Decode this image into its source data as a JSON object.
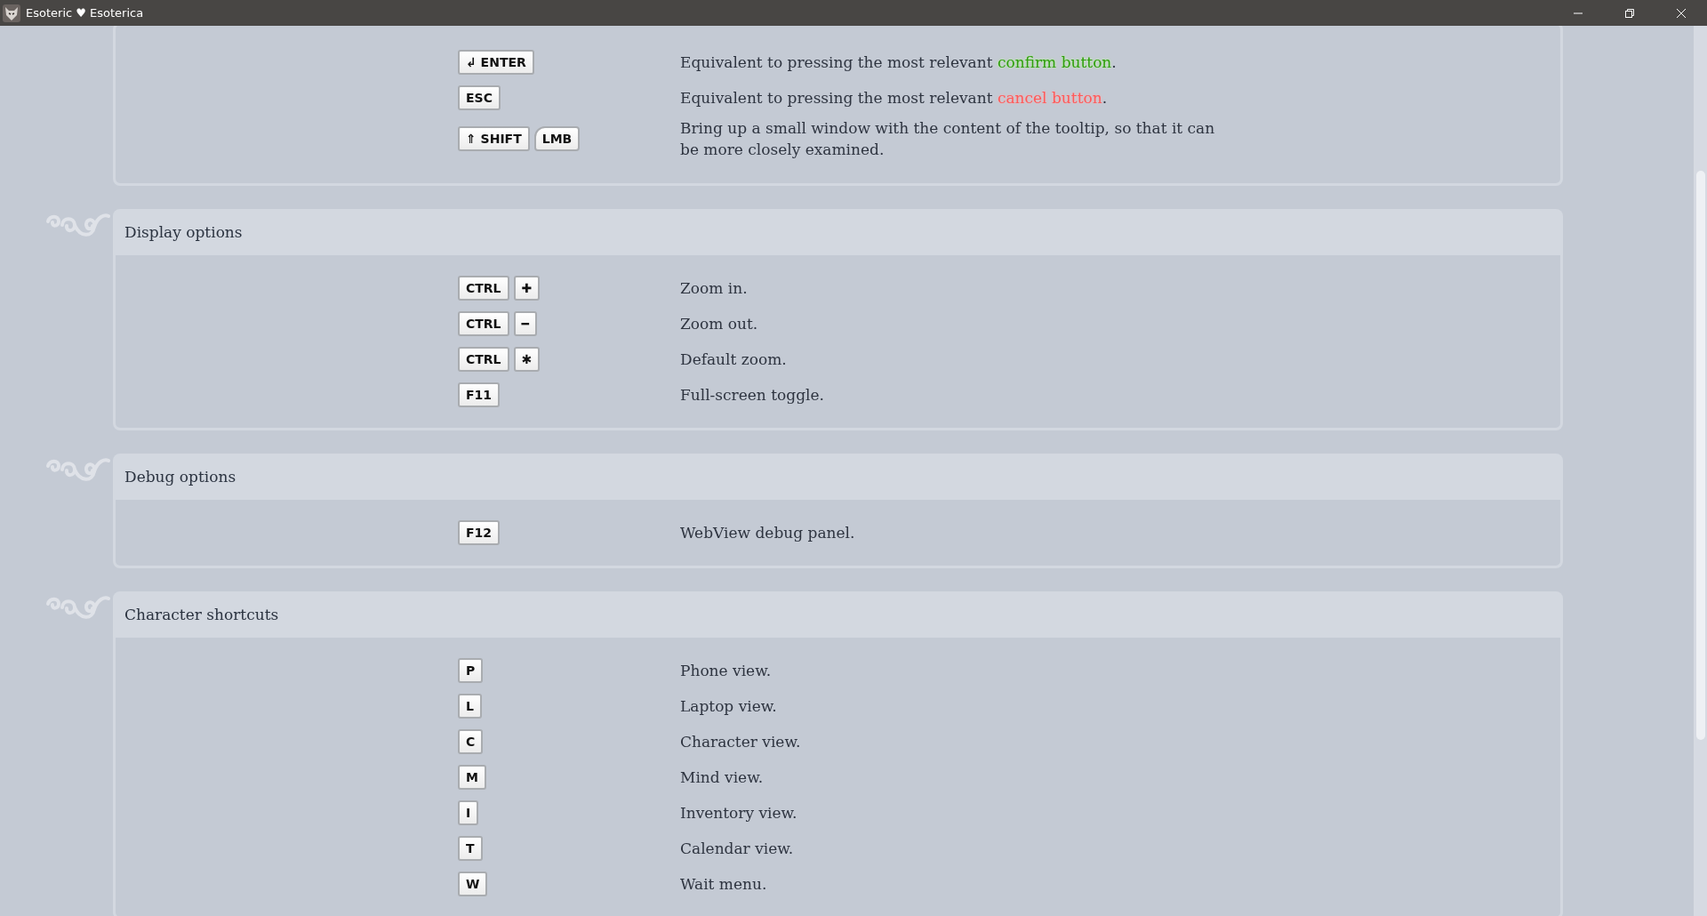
{
  "window": {
    "title": "Esoteric ♥ Esoterica"
  },
  "sections": [
    {
      "rows": [
        {
          "keys": [
            {
              "label": "↲ ENTER",
              "kind": "key"
            }
          ],
          "description": [
            {
              "text": "Equivalent to pressing the most relevant ",
              "kind": "plain"
            },
            {
              "text": "confirm button",
              "kind": "confirm"
            },
            {
              "text": ".",
              "kind": "plain"
            }
          ]
        },
        {
          "keys": [
            {
              "label": "ESC",
              "kind": "key"
            }
          ],
          "description": [
            {
              "text": "Equivalent to pressing the most relevant ",
              "kind": "plain"
            },
            {
              "text": "cancel button",
              "kind": "cancel"
            },
            {
              "text": ".",
              "kind": "plain"
            }
          ]
        },
        {
          "keys": [
            {
              "label": "⇑ SHIFT",
              "kind": "key"
            },
            {
              "label": "LMB",
              "kind": "mouse"
            }
          ],
          "description": [
            {
              "text": "Bring up a small window with the content of the tooltip, so that it can be more closely examined.",
              "kind": "plain"
            }
          ]
        }
      ]
    },
    {
      "title": "Display options",
      "rows": [
        {
          "keys": [
            {
              "label": "CTRL",
              "kind": "key"
            },
            {
              "label": "✚",
              "kind": "key"
            }
          ],
          "description": [
            {
              "text": "Zoom in.",
              "kind": "plain"
            }
          ]
        },
        {
          "keys": [
            {
              "label": "CTRL",
              "kind": "key"
            },
            {
              "label": "━",
              "kind": "key"
            }
          ],
          "description": [
            {
              "text": "Zoom out.",
              "kind": "plain"
            }
          ]
        },
        {
          "keys": [
            {
              "label": "CTRL",
              "kind": "key"
            },
            {
              "label": "✱",
              "kind": "key"
            }
          ],
          "description": [
            {
              "text": "Default zoom.",
              "kind": "plain"
            }
          ]
        },
        {
          "keys": [
            {
              "label": "F11",
              "kind": "key"
            }
          ],
          "description": [
            {
              "text": "Full-screen toggle.",
              "kind": "plain"
            }
          ]
        }
      ]
    },
    {
      "title": "Debug options",
      "rows": [
        {
          "keys": [
            {
              "label": "F12",
              "kind": "key"
            }
          ],
          "description": [
            {
              "text": "WebView debug panel.",
              "kind": "plain"
            }
          ]
        }
      ]
    },
    {
      "title": "Character shortcuts",
      "rows": [
        {
          "keys": [
            {
              "label": "P",
              "kind": "key"
            }
          ],
          "description": [
            {
              "text": "Phone view.",
              "kind": "plain"
            }
          ]
        },
        {
          "keys": [
            {
              "label": "L",
              "kind": "key"
            }
          ],
          "description": [
            {
              "text": "Laptop view.",
              "kind": "plain"
            }
          ]
        },
        {
          "keys": [
            {
              "label": "C",
              "kind": "key"
            }
          ],
          "description": [
            {
              "text": "Character view.",
              "kind": "plain"
            }
          ]
        },
        {
          "keys": [
            {
              "label": "M",
              "kind": "key"
            }
          ],
          "description": [
            {
              "text": "Mind view.",
              "kind": "plain"
            }
          ]
        },
        {
          "keys": [
            {
              "label": "I",
              "kind": "key"
            }
          ],
          "description": [
            {
              "text": "Inventory view.",
              "kind": "plain"
            }
          ]
        },
        {
          "keys": [
            {
              "label": "T",
              "kind": "key"
            }
          ],
          "description": [
            {
              "text": "Calendar view.",
              "kind": "plain"
            }
          ]
        },
        {
          "keys": [
            {
              "label": "W",
              "kind": "key"
            }
          ],
          "description": [
            {
              "text": "Wait menu.",
              "kind": "plain"
            }
          ]
        }
      ]
    }
  ]
}
